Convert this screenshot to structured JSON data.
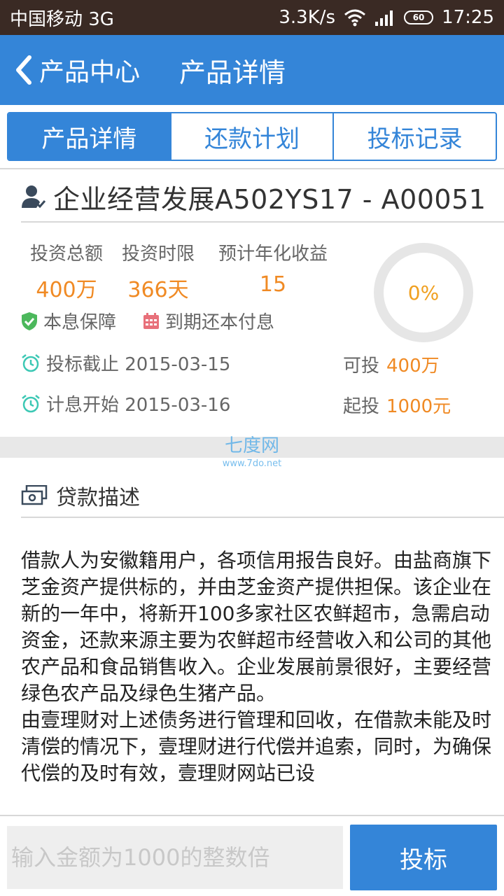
{
  "status_bar": {
    "carrier": "中国移动 3G",
    "speed": "3.3K/s",
    "battery": "60",
    "time": "17:25"
  },
  "nav": {
    "back_label": "产品中心",
    "title": "产品详情"
  },
  "tabs": [
    {
      "label": "产品详情",
      "active": true
    },
    {
      "label": "还款计划",
      "active": false
    },
    {
      "label": "投标记录",
      "active": false
    }
  ],
  "product": {
    "name": "企业经营发展A502YS17 - A00051",
    "stats": [
      {
        "label": "投资总额",
        "value": "400万"
      },
      {
        "label": "投资时限",
        "value": "366天"
      },
      {
        "label": "预计年化收益",
        "value": "15"
      }
    ],
    "progress_text": "0%",
    "progress_fraction": 0,
    "features": [
      "本息保障",
      "到期还本付息"
    ],
    "deadline": "投标截止 2015-03-15",
    "interest_start": "计息开始 2015-03-16",
    "available_label": "可投",
    "available_value": "400万",
    "min_label": "起投",
    "min_value": "1000元"
  },
  "watermark": {
    "name": "七度网",
    "url": "www.7do.net"
  },
  "loan": {
    "section_title": "贷款描述",
    "paragraphs": [
      "借款人为安徽籍用户，各项信用报告良好。由盐商旗下芝金资产提供标的，并由芝金资产提供担保。该企业在新的一年中，将新开100多家社区农鲜超市，急需启动资金，还款来源主要为农鲜超市经营收入和公司的其他农产品和食品销售收入。企业发展前景很好，主要经营绿色农产品及绿色生猪产品。",
      "由壹理财对上述债务进行管理和回收，在借款未能及时清偿的情况下，壹理财进行代偿并追索，同时，为确保代偿的及时有效，壹理财网站已设"
    ]
  },
  "bid": {
    "placeholder": "输入金额为1000的整数倍",
    "button_label": "投标"
  },
  "colors": {
    "primary": "#3485d8",
    "accent": "#f08a24",
    "status_bar": "#3a2a24",
    "shield": "#4cb85c",
    "calendar": "#e8707a",
    "alarm": "#3cc8b4"
  }
}
